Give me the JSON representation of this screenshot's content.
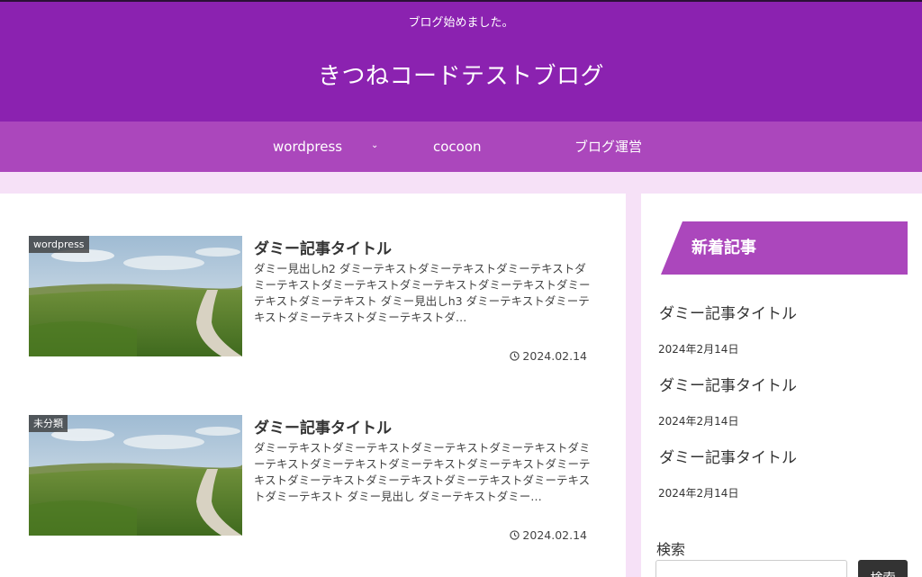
{
  "header": {
    "tagline": "ブログ始めました。",
    "site_title": "きつねコードテストブログ"
  },
  "nav": {
    "items": [
      {
        "label": "wordpress",
        "has_submenu": true
      },
      {
        "label": "cocoon"
      },
      {
        "label": "ブログ運営"
      }
    ]
  },
  "posts": [
    {
      "category": "wordpress",
      "title": "ダミー記事タイトル",
      "snippet": "ダミー見出しh2 ダミーテキストダミーテキストダミーテキストダミーテキストダミーテキストダミーテキストダミーテキストダミーテキストダミーテキスト ダミー見出しh3 ダミーテキストダミーテキストダミーテキストダミーテキストダ…",
      "date": "2024.02.14"
    },
    {
      "category": "未分類",
      "title": "ダミー記事タイトル",
      "snippet": "ダミーテキストダミーテキストダミーテキストダミーテキストダミーテキストダミーテキストダミーテキストダミーテキストダミーテキストダミーテキストダミーテキストダミーテキストダミーテキストダミーテキスト ダミー見出し ダミーテキストダミー…",
      "date": "2024.02.14"
    }
  ],
  "sidebar": {
    "recent_heading": "新着記事",
    "recent_posts": [
      {
        "title": "ダミー記事タイトル",
        "date": "2024年2月14日"
      },
      {
        "title": "ダミー記事タイトル",
        "date": "2024年2月14日"
      },
      {
        "title": "ダミー記事タイトル",
        "date": "2024年2月14日"
      }
    ],
    "search_label": "検索",
    "search_button": "検索"
  },
  "colors": {
    "header_bg": "#8b22b0",
    "nav_bg": "#ab47bc",
    "page_bg": "#f6e1f7",
    "sidebar_heading_bg": "#ab47bc"
  }
}
